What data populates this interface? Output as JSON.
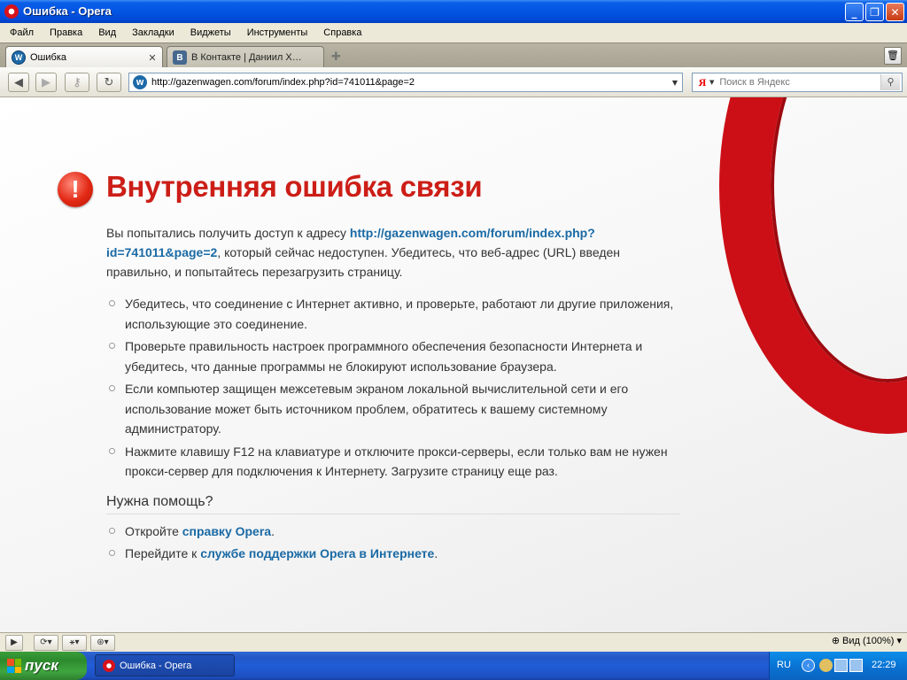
{
  "window": {
    "title": "Ошибка - Opera"
  },
  "menu": [
    "Файл",
    "Правка",
    "Вид",
    "Закладки",
    "Виджеты",
    "Инструменты",
    "Справка"
  ],
  "tabs": [
    {
      "label": "Ошибка",
      "active": true,
      "icon": "vw-icon"
    },
    {
      "label": "В Контакте | Даниил Х…",
      "active": false,
      "icon": "vk-icon"
    }
  ],
  "address": {
    "url": "http://gazenwagen.com/forum/index.php?id=741011&page=2"
  },
  "search": {
    "placeholder": "Поиск в Яндекс",
    "engine_glyph": "Я"
  },
  "error": {
    "title": "Внутренняя ошибка связи",
    "intro_before": "Вы попытались получить доступ к адресу ",
    "intro_link": "http://gazenwagen.com/forum/index.php?id=741011&page=2",
    "intro_after": ", который сейчас недоступен. Убедитесь, что веб-адрес (URL) введен правильно, и попытайтесь перезагрузить страницу.",
    "tips": [
      "Убедитесь, что соединение с Интернет активно, и проверьте, работают ли другие приложения, использующие это соединение.",
      "Проверьте правильность настроек программного обеспечения безопасности Интернета и убедитесь, что данные программы не блокируют использование браузера.",
      "Если компьютер защищен межсетевым экраном локальной вычислительной сети и его использование может быть источником проблем, обратитесь к вашему системному администратору.",
      "Нажмите клавишу F12 на клавиатуре и отключите прокси-серверы, если только вам не нужен прокси-сервер для подключения к Интернету. Загрузите страницу еще раз."
    ],
    "help_heading": "Нужна помощь?",
    "help": [
      {
        "before": "Откройте ",
        "link": "справку Opera",
        "after": "."
      },
      {
        "before": "Перейдите к ",
        "link": "службе поддержки Opera в Интернете",
        "after": "."
      }
    ]
  },
  "statusbar": {
    "zoom_label": "Вид (100%)"
  },
  "taskbar": {
    "start_label": "пуск",
    "window_item": "Ошибка - Opera",
    "lang": "RU",
    "clock": "22:29"
  },
  "colors": {
    "accent_red": "#cc1e17",
    "link": "#1a6aa5",
    "xp_blue": "#0255e2"
  }
}
